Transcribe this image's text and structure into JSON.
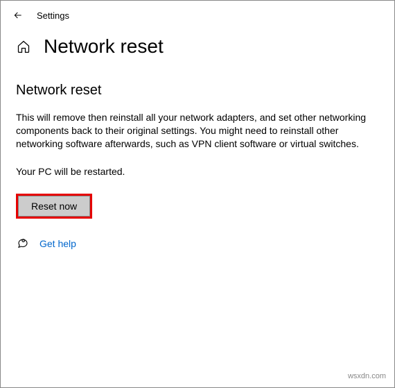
{
  "header": {
    "app_title": "Settings"
  },
  "page": {
    "title": "Network reset",
    "section_heading": "Network reset",
    "description": "This will remove then reinstall all your network adapters, and set other networking components back to their original settings. You might need to reinstall other networking software afterwards, such as VPN client software or virtual switches.",
    "restart_note": "Your PC will be restarted.",
    "reset_button_label": "Reset now"
  },
  "help": {
    "label": "Get help"
  },
  "watermark": "wsxdn.com"
}
